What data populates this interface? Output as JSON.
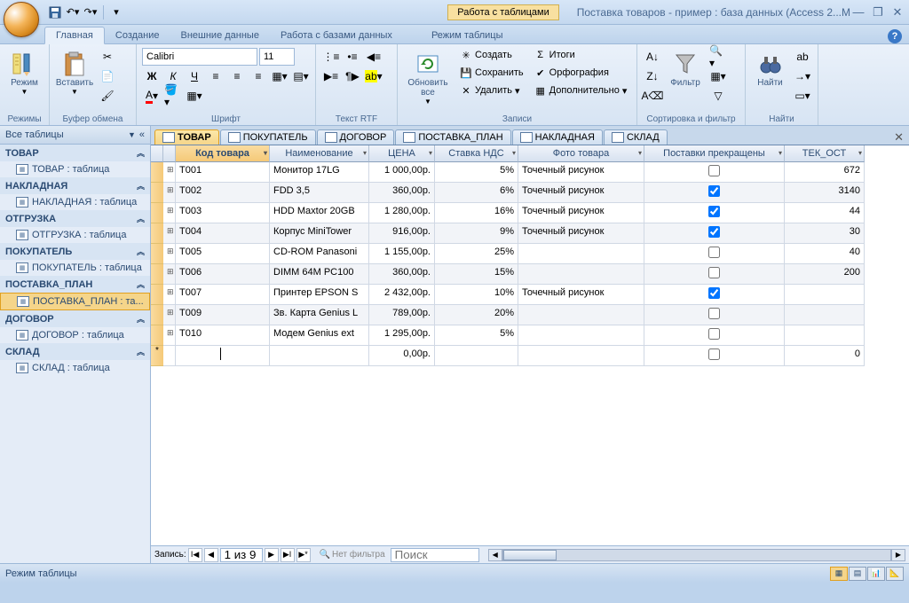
{
  "title": "Поставка товаров - пример : база данных (Access 2...M",
  "context_tab": "Работа с таблицами",
  "ribbon_tabs": [
    "Главная",
    "Создание",
    "Внешние данные",
    "Работа с базами данных",
    "Режим таблицы"
  ],
  "active_ribbon": 0,
  "groups": {
    "modes": "Режимы",
    "mode_btn": "Режим",
    "clipboard": "Буфер обмена",
    "paste_btn": "Вставить",
    "font": "Шрифт",
    "rtf": "Текст RTF",
    "records": "Записи",
    "sortfilter": "Сортировка и фильтр",
    "find": "Найти",
    "refresh_btn": "Обновить все",
    "filter_btn": "Фильтр",
    "find_btn": "Найти",
    "font_name": "Calibri",
    "font_size": "11",
    "rec_create": "Создать",
    "rec_save": "Сохранить",
    "rec_delete": "Удалить",
    "rec_totals": "Итоги",
    "rec_spell": "Орфография",
    "rec_more": "Дополнительно"
  },
  "nav": {
    "header": "Все таблицы",
    "groups": [
      {
        "h": "ТОВАР",
        "items": [
          "ТОВАР : таблица"
        ]
      },
      {
        "h": "НАКЛАДНАЯ",
        "items": [
          "НАКЛАДНАЯ : таблица"
        ]
      },
      {
        "h": "ОТГРУЗКА",
        "items": [
          "ОТГРУЗКА : таблица"
        ]
      },
      {
        "h": "ПОКУПАТЕЛЬ",
        "items": [
          "ПОКУПАТЕЛЬ : таблица"
        ]
      },
      {
        "h": "ПОСТАВКА_ПЛАН",
        "items": [
          "ПОСТАВКА_ПЛАН : та..."
        ],
        "sel": true
      },
      {
        "h": "ДОГОВОР",
        "items": [
          "ДОГОВОР : таблица"
        ]
      },
      {
        "h": "СКЛАД",
        "items": [
          "СКЛАД : таблица"
        ]
      }
    ]
  },
  "doctabs": [
    "ТОВАР",
    "ПОКУПАТЕЛЬ",
    "ДОГОВОР",
    "ПОСТАВКА_ПЛАН",
    "НАКЛАДНАЯ",
    "СКЛАД"
  ],
  "active_doctab": 0,
  "columns": [
    "Код товара",
    "Наименование",
    "ЦЕНА",
    "Ставка НДС",
    "Фото товара",
    "Поставки прекращены",
    "ТЕК_ОСТ"
  ],
  "rows": [
    {
      "id": "T001",
      "name": "Монитор 17LG",
      "price": "1 000,00р.",
      "vat": "5%",
      "photo": "Точечный рисунок",
      "stop": false,
      "rest": "672"
    },
    {
      "id": "T002",
      "name": "FDD 3,5",
      "price": "360,00р.",
      "vat": "6%",
      "photo": "Точечный рисунок",
      "stop": true,
      "rest": "3140"
    },
    {
      "id": "T003",
      "name": "HDD Maxtor 20GB",
      "price": "1 280,00р.",
      "vat": "16%",
      "photo": "Точечный рисунок",
      "stop": true,
      "rest": "44"
    },
    {
      "id": "T004",
      "name": "Корпус MiniTower",
      "price": "916,00р.",
      "vat": "9%",
      "photo": "Точечный рисунок",
      "stop": true,
      "rest": "30"
    },
    {
      "id": "T005",
      "name": "CD-ROM Panasoni",
      "price": "1 155,00р.",
      "vat": "25%",
      "photo": "",
      "stop": false,
      "rest": "40"
    },
    {
      "id": "T006",
      "name": "DIMM 64M PC100",
      "price": "360,00р.",
      "vat": "15%",
      "photo": "",
      "stop": false,
      "rest": "200"
    },
    {
      "id": "T007",
      "name": "Принтер EPSON S",
      "price": "2 432,00р.",
      "vat": "10%",
      "photo": "Точечный рисунок",
      "stop": true,
      "rest": ""
    },
    {
      "id": "T009",
      "name": "Зв. Карта Genius L",
      "price": "789,00р.",
      "vat": "20%",
      "photo": "",
      "stop": false,
      "rest": ""
    },
    {
      "id": "T010",
      "name": "Модем Genius ext",
      "price": "1 295,00р.",
      "vat": "5%",
      "photo": "",
      "stop": false,
      "rest": ""
    }
  ],
  "newrow": {
    "price": "0,00р.",
    "rest": "0"
  },
  "recnav": {
    "label": "Запись:",
    "pos": "1 из 9",
    "nofilter": "Нет фильтра",
    "search": "Поиск"
  },
  "status": "Режим таблицы"
}
